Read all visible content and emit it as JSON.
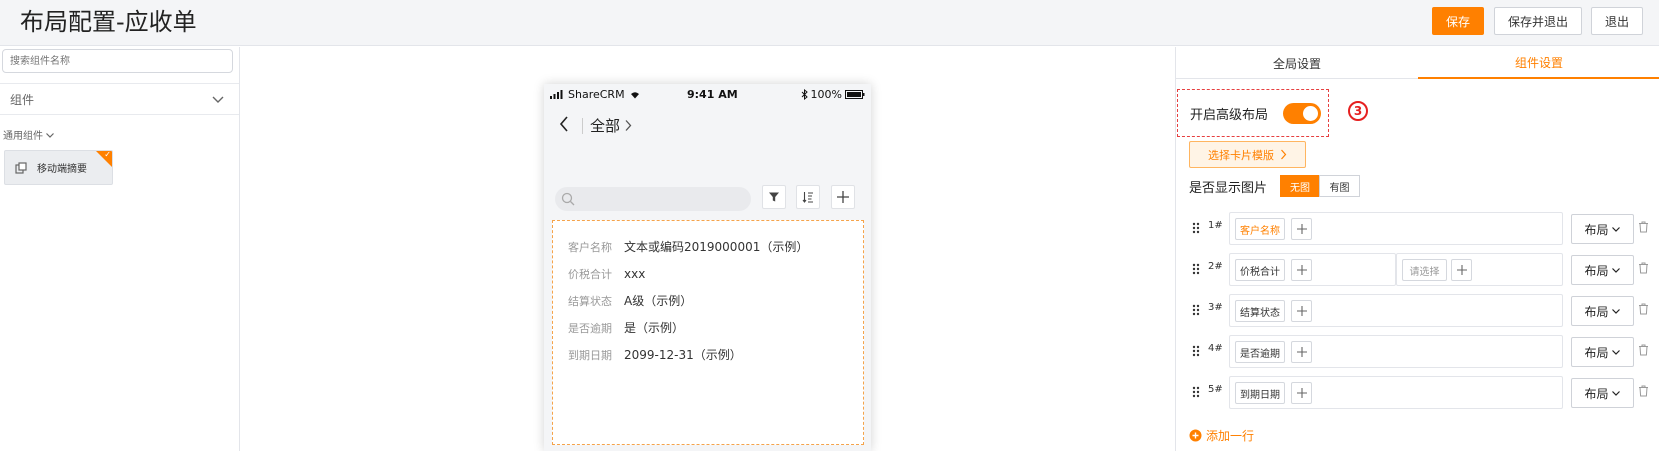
{
  "header": {
    "title": "布局配置-应收单",
    "save_label": "保存",
    "save_exit_label": "保存并退出",
    "exit_label": "退出"
  },
  "left": {
    "search_placeholder": "搜索组件名称",
    "group_label": "组件",
    "sub_group_label": "通用组件",
    "component_label": "移动端摘要"
  },
  "phone": {
    "carrier": "ShareCRM",
    "time": "9:41 AM",
    "battery": "100%",
    "nav_title": "全部",
    "fields": [
      {
        "label": "客户名称",
        "value": "文本或编码2019000001（示例）"
      },
      {
        "label": "价税合计",
        "value": "xxx"
      },
      {
        "label": "结算状态",
        "value": "A级（示例）"
      },
      {
        "label": "是否逾期",
        "value": "是（示例）"
      },
      {
        "label": "到期日期",
        "value": "2099-12-31（示例）"
      }
    ]
  },
  "right": {
    "tabs": [
      {
        "label": "全局设置",
        "active": false
      },
      {
        "label": "组件设置",
        "active": true
      }
    ],
    "advanced_layout_label": "开启高级布局",
    "advanced_layout_on": true,
    "step_marker": "③",
    "template_button_label": "选择卡片模版",
    "show_image_label": "是否显示图片",
    "image_options": [
      {
        "label": "无图",
        "selected": true
      },
      {
        "label": "有图",
        "selected": false
      }
    ],
    "rows": [
      {
        "index": "1#",
        "field": "客户名称",
        "highlight": true,
        "extra": "",
        "layout": "布局"
      },
      {
        "index": "2#",
        "field": "价税合计",
        "highlight": false,
        "extra": "请选择",
        "layout": "布局"
      },
      {
        "index": "3#",
        "field": "结算状态",
        "highlight": false,
        "extra": "",
        "layout": "布局"
      },
      {
        "index": "4#",
        "field": "是否逾期",
        "highlight": false,
        "extra": "",
        "layout": "布局"
      },
      {
        "index": "5#",
        "field": "到期日期",
        "highlight": false,
        "extra": "",
        "layout": "布局"
      }
    ],
    "add_row_label": "添加一行"
  },
  "colors": {
    "accent": "#ff8000",
    "danger": "#e62020"
  }
}
